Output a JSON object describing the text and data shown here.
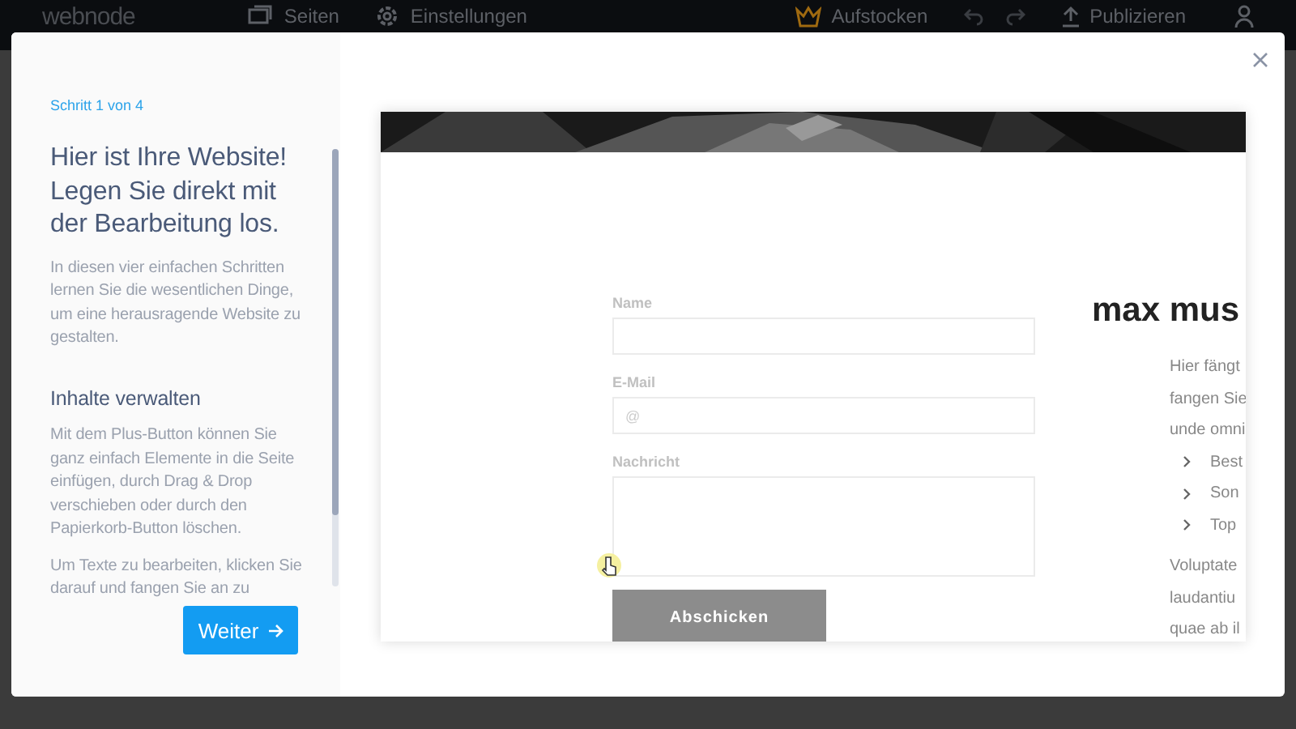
{
  "app_bar": {
    "logo": "webnode",
    "nav": [
      "Seiten",
      "Einstellungen"
    ],
    "upgrade": "Aufstocken",
    "publish": "Publizieren"
  },
  "guide": {
    "step": "Schritt 1 von 4",
    "title": "Hier ist Ihre Website! Legen Sie direkt mit der Bearbeitung los.",
    "intro": "In diesen vier einfachen Schritten lernen Sie die wesentlichen Dinge, um eine herausragende Website zu gestalten.",
    "section": "Inhalte verwalten",
    "paragraphs": [
      "Mit dem Plus-Button können Sie ganz einfach Elemente in die Seite einfügen, durch Drag & Drop verschieben oder durch den Papierkorb-Button löschen.",
      "Um Texte zu bearbeiten, klicken Sie darauf und fangen Sie an zu"
    ],
    "next_button": "Weiter"
  },
  "preview": {
    "form": {
      "fields": [
        {
          "label": "Name",
          "kind": "line"
        },
        {
          "label": "E-Mail",
          "kind": "line",
          "placeholder": "@"
        },
        {
          "label": "Nachricht",
          "kind": "area"
        }
      ],
      "submit": "Abschicken"
    },
    "heading": "max mus",
    "lines": [
      "Hier fängt",
      "fangen Sie",
      "unde omni"
    ],
    "bullets": [
      "Best",
      "Son",
      "Top"
    ],
    "lines_after": [
      "Voluptate",
      "laudantiu",
      "quae ab il"
    ]
  }
}
